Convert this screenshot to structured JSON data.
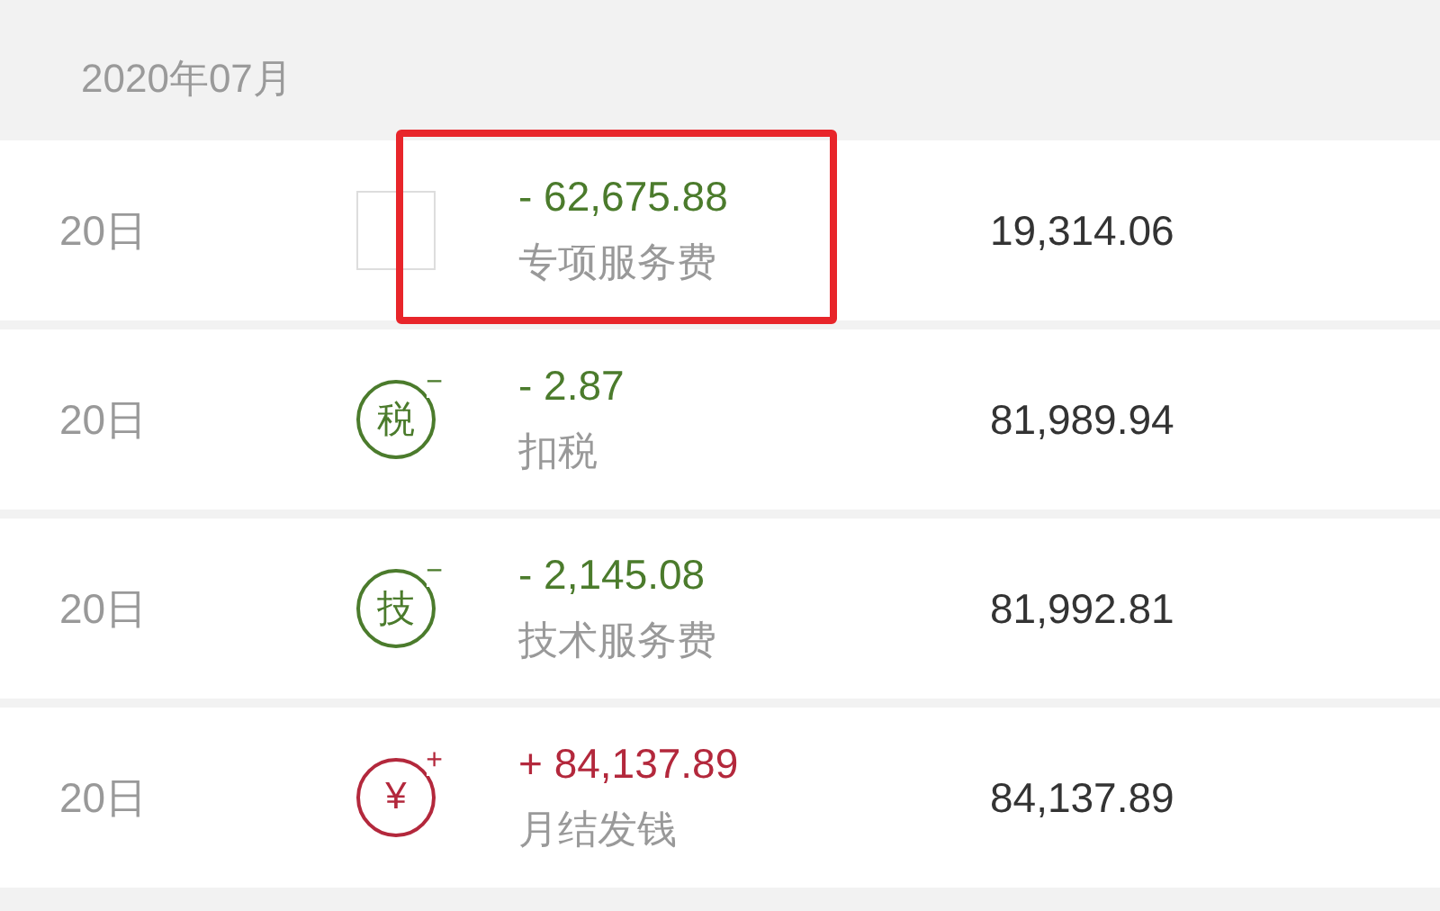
{
  "month_header": "2020年07月",
  "rows": [
    {
      "day": "20日",
      "icon": {
        "kind": "blank"
      },
      "amount": "- 62,675.88",
      "description": "专项服务费",
      "balance": "19,314.06",
      "color": "#4b7b2c",
      "highlighted": true
    },
    {
      "day": "20日",
      "icon": {
        "kind": "badge",
        "glyph": "税",
        "sign": "−"
      },
      "amount": "- 2.87",
      "description": "扣税",
      "balance": "81,989.94",
      "color": "#4b7b2c",
      "highlighted": false
    },
    {
      "day": "20日",
      "icon": {
        "kind": "badge",
        "glyph": "技",
        "sign": "−"
      },
      "amount": "- 2,145.08",
      "description": "技术服务费",
      "balance": "81,992.81",
      "color": "#4b7b2c",
      "highlighted": false
    },
    {
      "day": "20日",
      "icon": {
        "kind": "badge",
        "glyph": "¥",
        "sign": "+"
      },
      "amount": "+ 84,137.89",
      "description": "月结发钱",
      "balance": "84,137.89",
      "color": "#b3283c",
      "highlighted": false
    }
  ]
}
